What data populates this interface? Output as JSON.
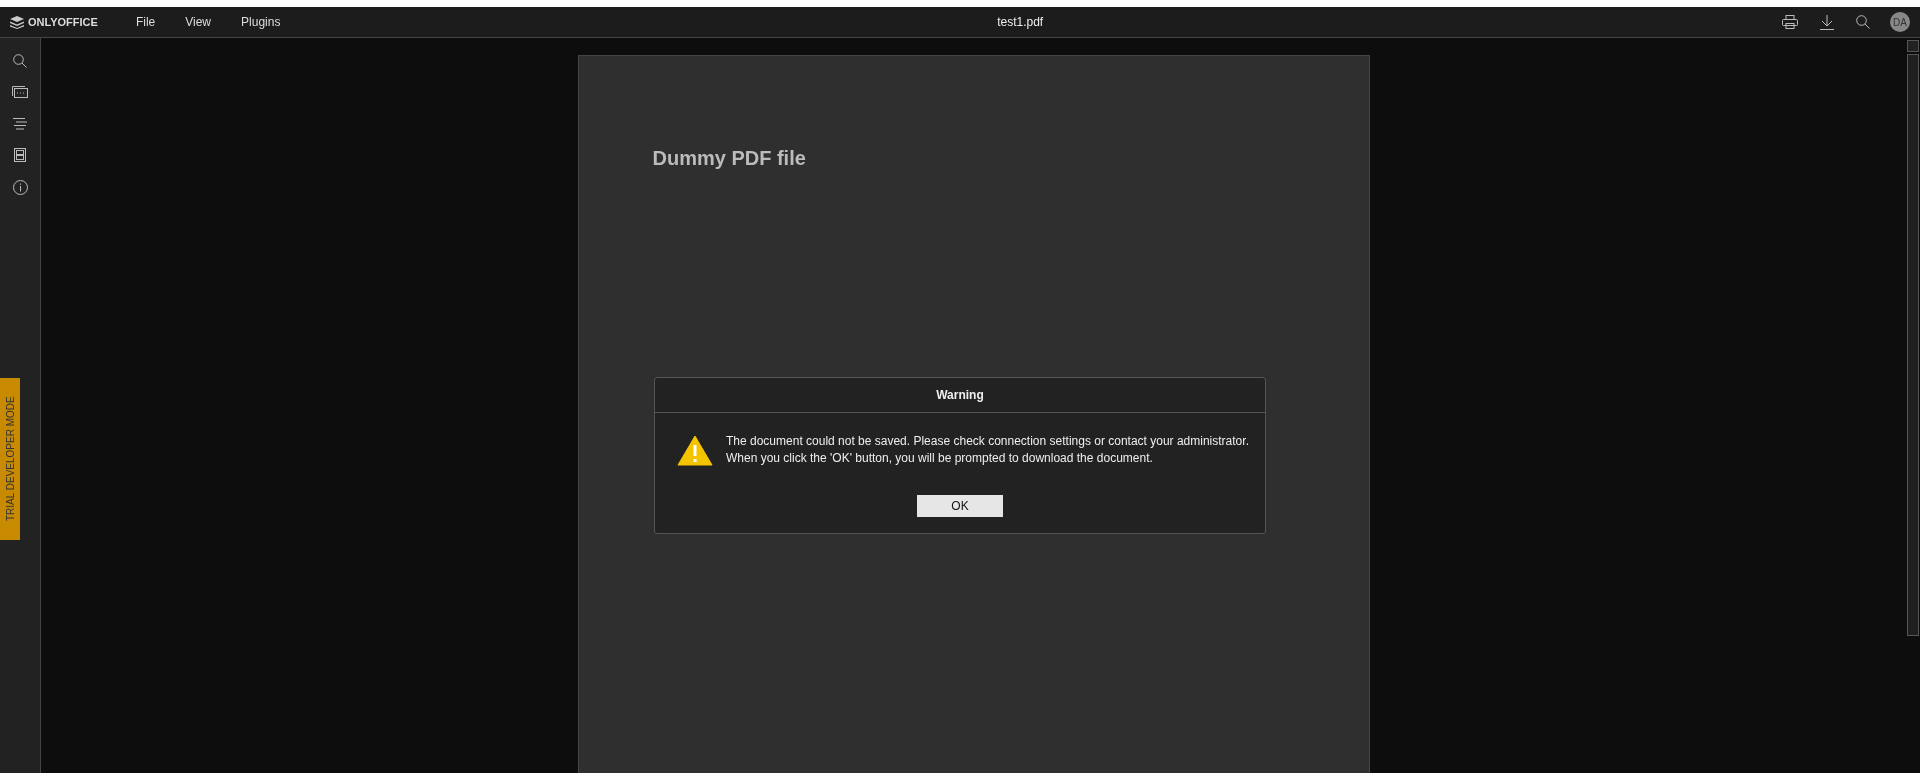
{
  "header": {
    "logo": "ONLYOFFICE",
    "menu": [
      "File",
      "View",
      "Plugins"
    ],
    "title": "test1.pdf",
    "avatar": "DA"
  },
  "trial_badge": "TRIAL DEVELOPER MODE",
  "document": {
    "heading": "Dummy PDF file"
  },
  "dialog": {
    "title": "Warning",
    "message": "The document could not be saved. Please check connection settings or contact your administrator.\nWhen you click the 'OK' button, you will be prompted to download the document.",
    "button": "OK"
  }
}
